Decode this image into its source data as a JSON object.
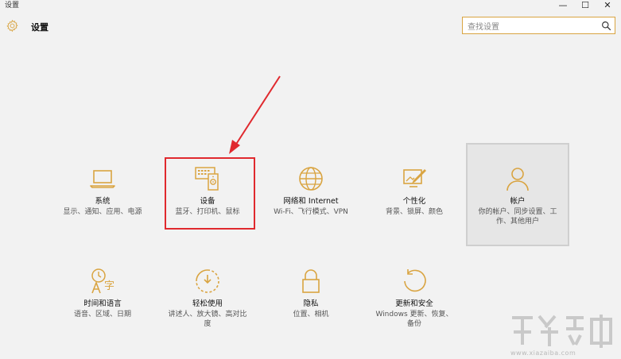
{
  "window": {
    "title": "设置",
    "minimize": "—",
    "maximize": "☐",
    "close": "✕"
  },
  "header": {
    "title": "设置",
    "search_placeholder": "查找设置"
  },
  "accent_color": "#d9a441",
  "tiles": [
    {
      "name": "系统",
      "desc": "显示、通知、应用、电源",
      "icon": "laptop-icon"
    },
    {
      "name": "设备",
      "desc": "蓝牙、打印机、鼠标",
      "icon": "devices-icon"
    },
    {
      "name": "网络和 Internet",
      "desc": "Wi-Fi、飞行模式、VPN",
      "icon": "globe-icon"
    },
    {
      "name": "个性化",
      "desc": "背景、锁屏、颜色",
      "icon": "personalization-icon"
    },
    {
      "name": "帐户",
      "desc": "你的帐户、同步设置、工作、其他用户",
      "icon": "person-icon"
    },
    {
      "name": "时间和语言",
      "desc": "语音、区域、日期",
      "icon": "time-language-icon"
    },
    {
      "name": "轻松使用",
      "desc": "讲述人、放大镜、高对比度",
      "icon": "ease-of-access-icon"
    },
    {
      "name": "隐私",
      "desc": "位置、相机",
      "icon": "lock-icon"
    },
    {
      "name": "更新和安全",
      "desc": "Windows 更新、恢复、备份",
      "icon": "update-icon"
    }
  ],
  "watermark": {
    "site": "www.xiazaiba.com"
  }
}
